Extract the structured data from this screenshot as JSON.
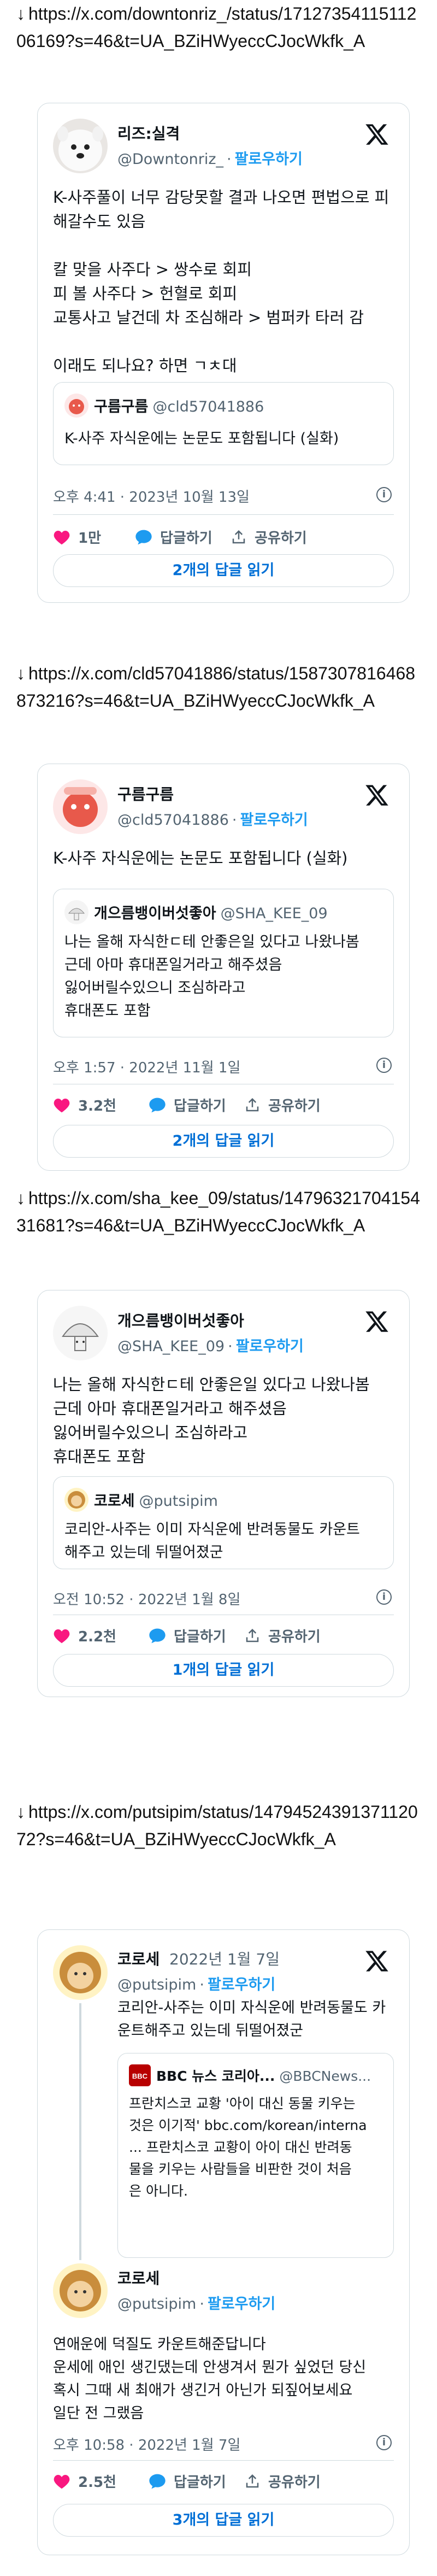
{
  "sections": [
    {
      "url": "https://x.com/downtonriz_/status/1712735411511206169?s=46&t=UA_BZiHWyeccCJocWkfk_A",
      "card": {
        "name": "리즈:실격",
        "handle": "@Downtonriz_",
        "follow": "팔로우하기",
        "text": "K-사주풀이 너무 감당못할 결과 나오면 편법으로 피해갈수도 있음\n\n칼 맞을 사주다 > 쌍수로 회피\n피 볼 사주다 > 헌혈로 회피\n교통사고 날건데 차 조심해라 > 범퍼카 타러 감\n\n이래도 되나요? 하면 ㄱㅊ대",
        "quote": {
          "name": "구름구름",
          "handle": "@cld57041886",
          "text": "K-사주 자식운에는 논문도 포함됩니다 (실화)"
        },
        "time": "오후 4:41 · 2023년 10월 13일",
        "likes": "1만",
        "reply": "답글하기",
        "share": "공유하기",
        "read_replies": "2개의 답글 읽기"
      }
    },
    {
      "url": "https://x.com/cld57041886/status/1587307816468873216?s=46&t=UA_BZiHWyeccCJocWkfk_A",
      "card": {
        "name": "구름구름",
        "handle": "@cld57041886",
        "follow": "팔로우하기",
        "text": "K-사주 자식운에는 논문도 포함됩니다 (실화)",
        "quote": {
          "name": "개으름뱅이버섯좋아",
          "handle": "@SHA_KEE_09",
          "text": "나는 올해 자식한ㄷ테 안좋은일 있다고 나왔나봄\n근데 아마 휴대폰일거라고 해주셨음\n잃어버릴수있으니 조심하라고\n휴대폰도 포함"
        },
        "time": "오후 1:57 · 2022년 11월 1일",
        "likes": "3.2천",
        "reply": "답글하기",
        "share": "공유하기",
        "read_replies": "2개의 답글 읽기"
      }
    },
    {
      "url": "https://x.com/sha_kee_09/status/1479632170415431681?s=46&t=UA_BZiHWyeccCJocWkfk_A",
      "card": {
        "name": "개으름뱅이버섯좋아",
        "handle": "@SHA_KEE_09",
        "follow": "팔로우하기",
        "text": "나는 올해 자식한ㄷ테 안좋은일 있다고 나왔나봄\n근데 아마 휴대폰일거라고 해주셨음\n잃어버릴수있으니 조심하라고\n휴대폰도 포함",
        "quote": {
          "name": "코로세",
          "handle": "@putsipim",
          "text": "코리안-사주는 이미 자식운에 반려동물도 카운트\n해주고 있는데 뒤떨어졌군"
        },
        "time": "오전 10:52 · 2022년 1월 8일",
        "likes": "2.2천",
        "reply": "답글하기",
        "share": "공유하기",
        "read_replies": "1개의 답글 읽기"
      }
    },
    {
      "url": "https://x.com/putsipim/status/1479452439137112072?s=46&t=UA_BZiHWyeccCJocWkfk_A",
      "card": {
        "top_name": "코로세",
        "top_date": "2022년 1월 7일",
        "top_handle": "@putsipim",
        "top_follow": "팔로우하기",
        "top_text": "코리안-사주는 이미 자식운에 반려동물도 카\n운트해주고 있는데 뒤떨어졌군",
        "bbc_name": "BBC 뉴스 코리아...",
        "bbc_handle": "@BBCNews...",
        "bbc_text": "프란치스코 교황 '아이 대신 동물 키우는\n것은 이기적' bbc.com/korean/interna\n... 프란치스코 교황이 아이 대신 반려동\n물을 키우는 사람들을 비판한 것이 처음\n은 아니다.",
        "name": "코로세",
        "handle": "@putsipim",
        "follow": "팔로우하기",
        "text": "연애운에 덕질도 카운트해준답니다\n운세에 애인 생긴댔는데 안생겨서 뭔가 싶었던 당신\n혹시 그때 새 최애가 생긴거 아닌가 되짚어보세요\n일단 전 그랬음",
        "time": "오후 10:58 · 2022년 1월 7일",
        "likes": "2.5천",
        "reply": "답글하기",
        "share": "공유하기",
        "read_replies": "3개의 답글 읽기"
      }
    }
  ],
  "icons": {
    "x_logo": "x-logo-icon",
    "heart": "heart-icon",
    "reply": "reply-bubble-icon",
    "share": "share-icon",
    "info": "info-icon"
  },
  "colors": {
    "heart": "#f91880",
    "reply_bubble": "#1d9bf0",
    "link": "#1d9bf0",
    "button_text": "#006fd6",
    "border": "#cfd9de"
  }
}
